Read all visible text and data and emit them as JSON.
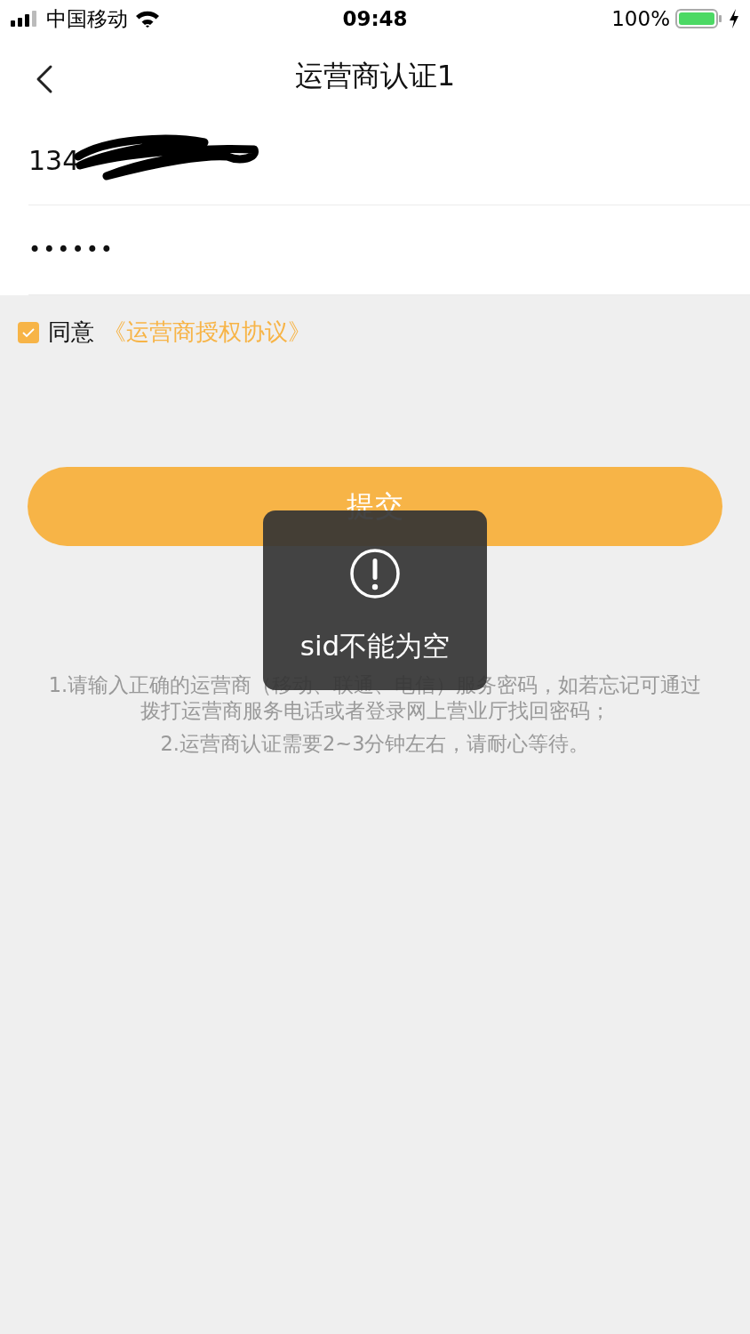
{
  "status_bar": {
    "carrier": "中国移动",
    "time": "09:48",
    "battery": "100%"
  },
  "nav": {
    "title": "运营商认证1"
  },
  "fields": [
    {
      "kind": "phone",
      "value": "134",
      "redacted": true
    },
    {
      "kind": "password",
      "value": "••••••",
      "redacted": false
    }
  ],
  "agreement": {
    "checked": true,
    "label": "同意",
    "link": "《运营商授权协议》"
  },
  "submit": {
    "label": "提交"
  },
  "hints": [
    "1.请输入正确的运营商（移动、联通、电信）服务密码，如若忘记可通过拨打运营商服务电话或者登录网上营业厅找回密码；",
    "2.运营商认证需要2~3分钟左右，请耐心等待。"
  ],
  "toast": {
    "message": "sid不能为空"
  }
}
